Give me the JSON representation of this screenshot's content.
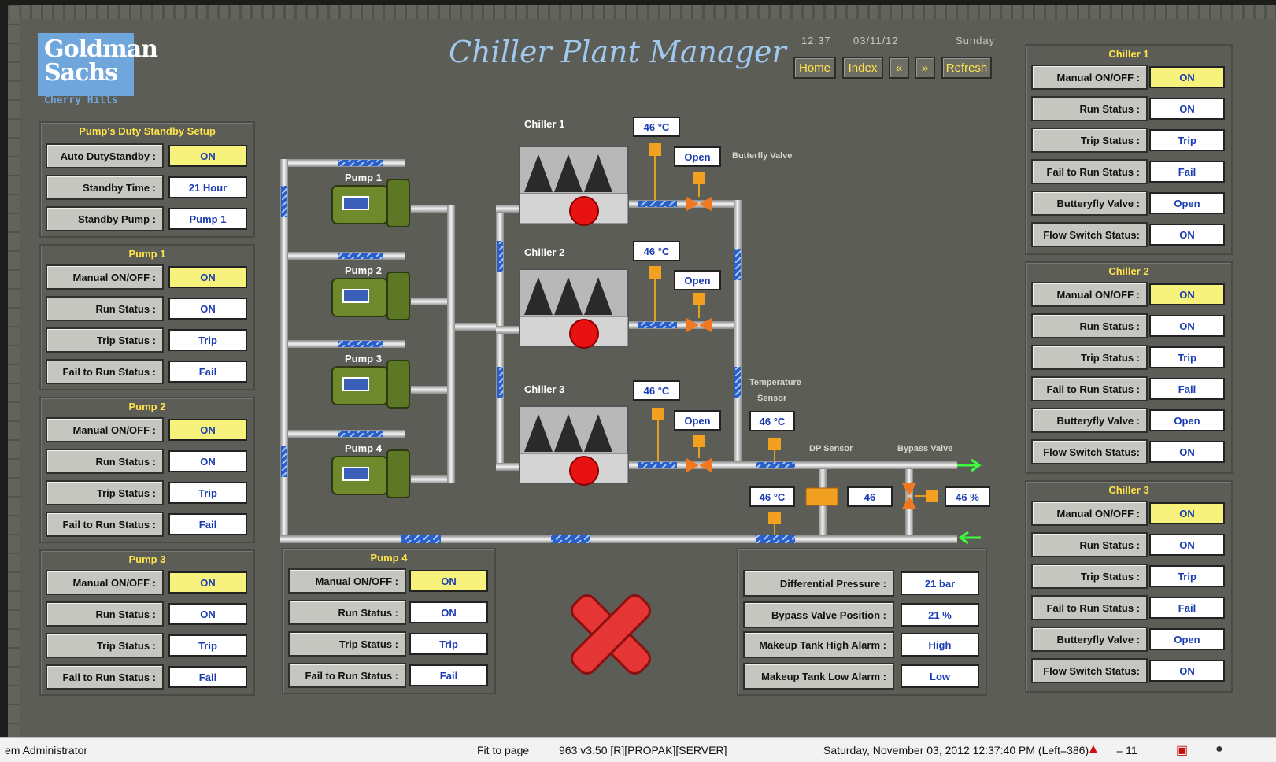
{
  "app": {
    "title": "Chiller Plant Manager",
    "logo_line1": "Goldman",
    "logo_line2": "Sachs",
    "logo_sub": "Cherry Hills"
  },
  "clock": {
    "time": "12:37",
    "date": "03/11/12",
    "day": "Sunday"
  },
  "nav": {
    "home": "Home",
    "index": "Index",
    "prev": "«",
    "next": "»",
    "refresh": "Refresh"
  },
  "pump_standby": {
    "title": "Pump's Duty Standby Setup",
    "rows": [
      {
        "label": "Auto DutyStandby :",
        "value": "ON"
      },
      {
        "label": "Standby Time :",
        "value": "21 Hour"
      },
      {
        "label": "Standby Pump :",
        "value": "Pump 1"
      }
    ]
  },
  "pumps": [
    {
      "title": "Pump 1",
      "rows": [
        {
          "label": "Manual ON/OFF :",
          "value": "ON"
        },
        {
          "label": "Run Status :",
          "value": "ON"
        },
        {
          "label": "Trip Status :",
          "value": "Trip"
        },
        {
          "label": "Fail to Run Status :",
          "value": "Fail"
        }
      ]
    },
    {
      "title": "Pump 2",
      "rows": [
        {
          "label": "Manual ON/OFF :",
          "value": "ON"
        },
        {
          "label": "Run Status :",
          "value": "ON"
        },
        {
          "label": "Trip Status :",
          "value": "Trip"
        },
        {
          "label": "Fail to Run Status :",
          "value": "Fail"
        }
      ]
    },
    {
      "title": "Pump 3",
      "rows": [
        {
          "label": "Manual ON/OFF :",
          "value": "ON"
        },
        {
          "label": "Run Status :",
          "value": "ON"
        },
        {
          "label": "Trip Status :",
          "value": "Trip"
        },
        {
          "label": "Fail to Run Status :",
          "value": "Fail"
        }
      ]
    },
    {
      "title": "Pump 4",
      "rows": [
        {
          "label": "Manual ON/OFF :",
          "value": "ON"
        },
        {
          "label": "Run Status :",
          "value": "ON"
        },
        {
          "label": "Trip Status :",
          "value": "Trip"
        },
        {
          "label": "Fail to Run Status :",
          "value": "Fail"
        }
      ]
    }
  ],
  "chillers": [
    {
      "title": "Chiller 1",
      "rows": [
        {
          "label": "Manual ON/OFF :",
          "value": "ON"
        },
        {
          "label": "Run Status :",
          "value": "ON"
        },
        {
          "label": "Trip Status :",
          "value": "Trip"
        },
        {
          "label": "Fail to Run Status :",
          "value": "Fail"
        },
        {
          "label": "Butteryfly Valve :",
          "value": "Open"
        },
        {
          "label": "Flow Switch Status:",
          "value": "ON"
        }
      ]
    },
    {
      "title": "Chiller 2",
      "rows": [
        {
          "label": "Manual ON/OFF :",
          "value": "ON"
        },
        {
          "label": "Run Status :",
          "value": "ON"
        },
        {
          "label": "Trip Status :",
          "value": "Trip"
        },
        {
          "label": "Fail to Run Status :",
          "value": "Fail"
        },
        {
          "label": "Butteryfly Valve :",
          "value": "Open"
        },
        {
          "label": "Flow Switch Status:",
          "value": "ON"
        }
      ]
    },
    {
      "title": "Chiller 3",
      "rows": [
        {
          "label": "Manual ON/OFF :",
          "value": "ON"
        },
        {
          "label": "Run Status :",
          "value": "ON"
        },
        {
          "label": "Trip Status :",
          "value": "Trip"
        },
        {
          "label": "Fail to Run Status :",
          "value": "Fail"
        },
        {
          "label": "Butteryfly Valve :",
          "value": "Open"
        },
        {
          "label": "Flow Switch Status:",
          "value": "ON"
        }
      ]
    }
  ],
  "system": {
    "rows": [
      {
        "label": "Differential Pressure :",
        "value": "21 bar"
      },
      {
        "label": "Bypass Valve Position :",
        "value": "21 %"
      },
      {
        "label": "Makeup Tank High Alarm :",
        "value": "High"
      },
      {
        "label": "Makeup Tank Low Alarm :",
        "value": "Low"
      }
    ]
  },
  "diagram": {
    "pump_labels": [
      "Pump 1",
      "Pump 2",
      "Pump 3",
      "Pump 4"
    ],
    "chiller_labels": [
      "Chiller 1",
      "Chiller 2",
      "Chiller 3"
    ],
    "chiller_temps": [
      "46 °C",
      "46 °C",
      "46 °C"
    ],
    "valve_states": [
      "Open",
      "Open",
      "Open"
    ],
    "butterfly_valve_label": "Butterfly Valve",
    "temp_sensor_label_1": "Temperature",
    "temp_sensor_label_2": "Sensor",
    "temp_sensor_value": "46 °C",
    "dp_sensor_label": "DP Sensor",
    "bypass_valve_label": "Bypass Valve",
    "return_temp": "46 °C",
    "dp_value": "46",
    "bypass_value": "46 %"
  },
  "statusbar": {
    "user": "em Administrator",
    "fit": "Fit to page",
    "server": "963 v3.50 [R][PROPAK][SERVER]",
    "datetime": "Saturday, November 03, 2012 12:37:40 PM (Left=386)",
    "alarm_count": "= 11"
  },
  "colors": {
    "background": "#5d5d57",
    "title": "#9fc9ee",
    "highlight": "#f7f27c",
    "value_text": "#1a3cb3",
    "panel_title": "#ffe44a"
  },
  "icons": [
    "warning-icon",
    "close-icon",
    "status-dot-icon"
  ]
}
